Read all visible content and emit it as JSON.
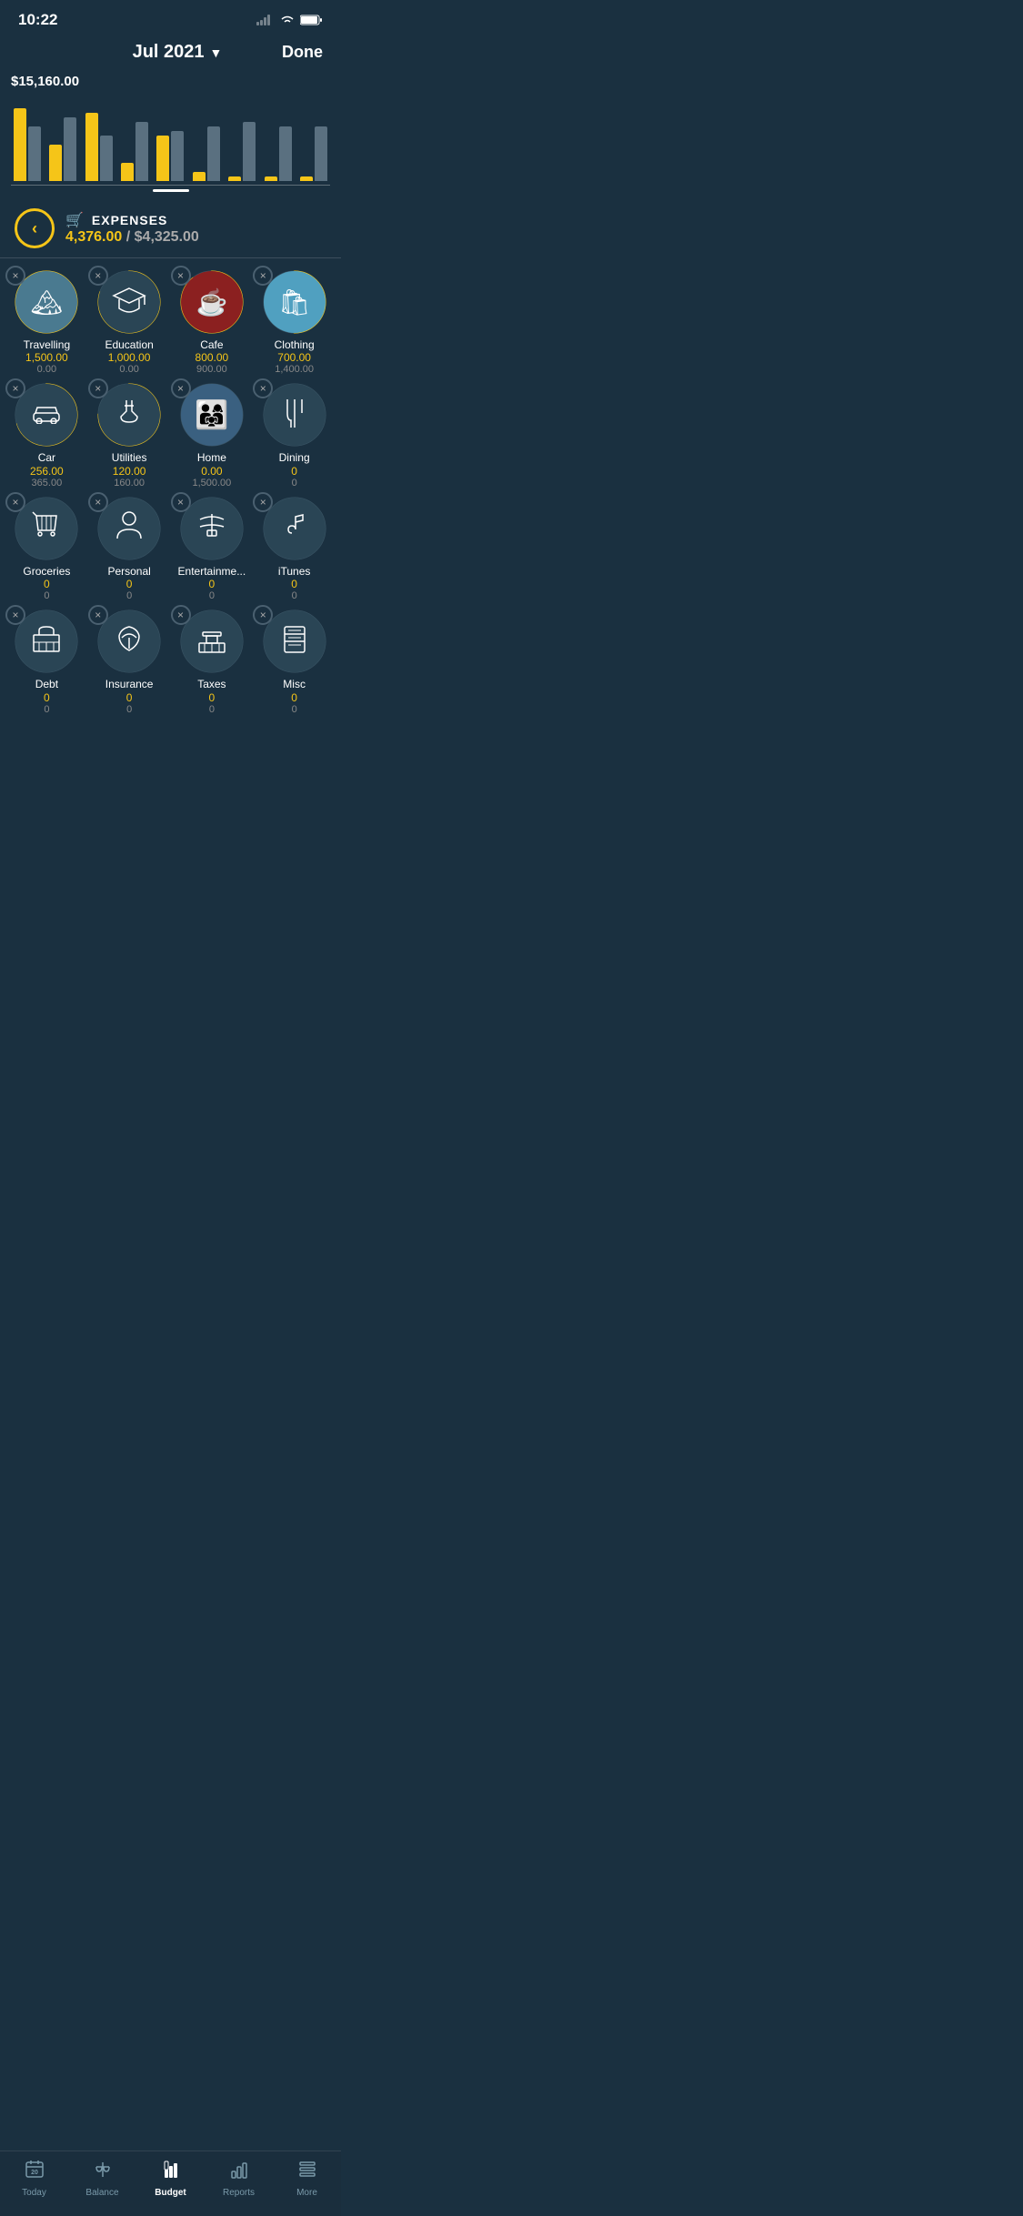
{
  "statusBar": {
    "time": "10:22"
  },
  "header": {
    "title": "Jul 2021",
    "chevron": "▼",
    "done": "Done"
  },
  "chart": {
    "amount": "$15,160.00",
    "bars": [
      {
        "yellow": 80,
        "gray": 60
      },
      {
        "yellow": 40,
        "gray": 70
      },
      {
        "yellow": 75,
        "gray": 50
      },
      {
        "yellow": 20,
        "gray": 65
      },
      {
        "yellow": 50,
        "gray": 55
      },
      {
        "yellow": 10,
        "gray": 60
      },
      {
        "yellow": 5,
        "gray": 65
      },
      {
        "yellow": 5,
        "gray": 60
      },
      {
        "yellow": 5,
        "gray": 60
      }
    ]
  },
  "expenses": {
    "title": "EXPENSES",
    "current": "4,376.00",
    "budget": "$4,325.00",
    "backLabel": "<"
  },
  "categories": [
    {
      "name": "Travelling",
      "spent": "1,500.00",
      "budget": "0.00",
      "icon": "🏔️",
      "hasPhoto": false,
      "progress": 100,
      "iconType": "emoji"
    },
    {
      "name": "Education",
      "spent": "1,000.00",
      "budget": "0.00",
      "icon": "🎓",
      "hasPhoto": false,
      "progress": 80,
      "iconType": "emoji",
      "darkBg": true
    },
    {
      "name": "Cafe",
      "spent": "800.00",
      "budget": "900.00",
      "icon": "☕",
      "hasPhoto": false,
      "progress": 89,
      "iconType": "emoji"
    },
    {
      "name": "Clothing",
      "spent": "700.00",
      "budget": "1,400.00",
      "icon": "🛍️",
      "hasPhoto": false,
      "progress": 50,
      "iconType": "emoji"
    },
    {
      "name": "Car",
      "spent": "256.00",
      "budget": "365.00",
      "icon": "🚗",
      "hasPhoto": false,
      "progress": 70,
      "iconType": "unicode"
    },
    {
      "name": "Utilities",
      "spent": "120.00",
      "budget": "160.00",
      "icon": "🔧",
      "hasPhoto": false,
      "progress": 75,
      "iconType": "unicode"
    },
    {
      "name": "Home",
      "spent": "0.00",
      "budget": "1,500.00",
      "icon": "👨‍👩‍👧",
      "hasPhoto": false,
      "progress": 0,
      "iconType": "emoji"
    },
    {
      "name": "Dining",
      "spent": "0",
      "budget": "0",
      "icon": "🍴",
      "hasPhoto": false,
      "progress": 0,
      "iconType": "unicode"
    },
    {
      "name": "Groceries",
      "spent": "0",
      "budget": "0",
      "icon": "🧺",
      "hasPhoto": false,
      "progress": 0,
      "iconType": "unicode"
    },
    {
      "name": "Personal",
      "spent": "0",
      "budget": "0",
      "icon": "👤",
      "hasPhoto": false,
      "progress": 0,
      "iconType": "unicode"
    },
    {
      "name": "Entertainme...",
      "spent": "0",
      "budget": "0",
      "icon": "🎠",
      "hasPhoto": false,
      "progress": 0,
      "iconType": "unicode"
    },
    {
      "name": "iTunes",
      "spent": "0",
      "budget": "0",
      "icon": "♪",
      "hasPhoto": false,
      "progress": 0,
      "iconType": "unicode"
    },
    {
      "name": "Debt",
      "spent": "0",
      "budget": "0",
      "icon": "🏛️",
      "hasPhoto": false,
      "progress": 0,
      "iconType": "unicode"
    },
    {
      "name": "Insurance",
      "spent": "0",
      "budget": "0",
      "icon": "☂️",
      "hasPhoto": false,
      "progress": 0,
      "iconType": "unicode"
    },
    {
      "name": "Taxes",
      "spent": "0",
      "budget": "0",
      "icon": "🏛",
      "hasPhoto": false,
      "progress": 0,
      "iconType": "unicode"
    },
    {
      "name": "Misc",
      "spent": "0",
      "budget": "0",
      "icon": "🗄️",
      "hasPhoto": false,
      "progress": 0,
      "iconType": "unicode"
    }
  ],
  "nav": {
    "items": [
      {
        "label": "Today",
        "icon": "📅",
        "active": false
      },
      {
        "label": "Balance",
        "icon": "⚖️",
        "active": false
      },
      {
        "label": "Budget",
        "icon": "📊",
        "active": true
      },
      {
        "label": "Reports",
        "icon": "📈",
        "active": false
      },
      {
        "label": "More",
        "icon": "📋",
        "active": false
      }
    ]
  }
}
